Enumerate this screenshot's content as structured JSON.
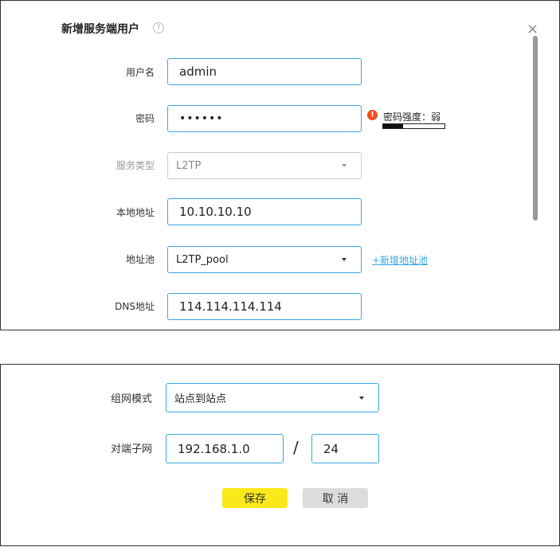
{
  "dialog": {
    "title": "新增服务端用户",
    "help_icon": "question-circle-icon",
    "close_icon": "close-icon"
  },
  "fields": {
    "username": {
      "label": "用户名",
      "value": "admin"
    },
    "password": {
      "label": "密码",
      "value": "••••••",
      "strength_label": "密码强度：弱",
      "strength_fraction": 0.33
    },
    "service_type": {
      "label": "服务类型",
      "value": "L2TP"
    },
    "local_address": {
      "label": "本地地址",
      "value": "10.10.10.10"
    },
    "address_pool": {
      "label": "地址池",
      "value": "L2TP_pool",
      "add_link": "+新增地址池"
    },
    "dns": {
      "label": "DNS地址",
      "value": "114.114.114.114"
    },
    "network_mode": {
      "label": "组网模式",
      "value": "站点到站点"
    },
    "peer_subnet": {
      "label": "对端子网",
      "ip": "192.168.1.0",
      "separator": "/",
      "mask": "24"
    }
  },
  "buttons": {
    "save": "保存",
    "cancel": "取 消"
  },
  "colors": {
    "accent": "#3aa7e0",
    "save": "#fbe81a",
    "cancel": "#dcdcdc",
    "warning": "#f04e1c"
  }
}
